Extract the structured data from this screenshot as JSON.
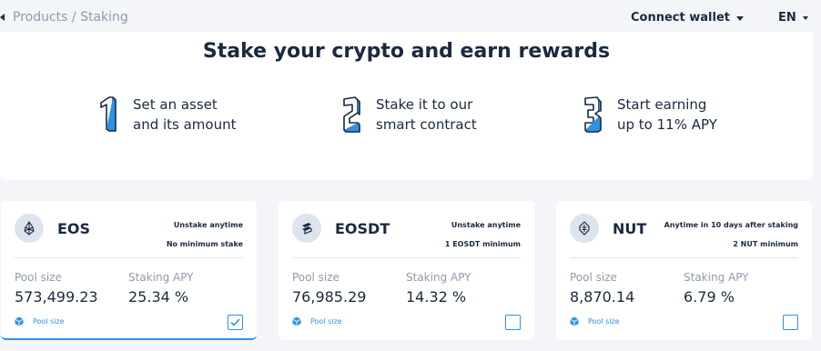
{
  "header": {
    "breadcrumb": "Products / Staking",
    "connect_wallet": "Connect wallet",
    "language": "EN"
  },
  "hero": {
    "title": "Stake your crypto and earn rewards",
    "steps": [
      {
        "line1": "Set an asset",
        "line2": "and its amount",
        "icon": "number-1-icon"
      },
      {
        "line1": "Stake it to our",
        "line2": "smart contract",
        "icon": "number-2-icon"
      },
      {
        "line1": "Start earning",
        "line2": "up to 11% APY",
        "icon": "number-3-icon"
      }
    ]
  },
  "colors": {
    "accent": "#2f91e8",
    "text": "#1b2940",
    "muted": "#8f9aad",
    "background": "#f3f5f9"
  },
  "pools": [
    {
      "name": "EOS",
      "icon": "eos-icon",
      "terms_line1": "Unstake anytime",
      "terms_line2": "No minimum stake",
      "pool_size_label": "Pool size",
      "pool_size": "573,499.23",
      "apy_label": "Staking APY",
      "apy": "25.34 %",
      "footer_link": "Pool size",
      "selected": true
    },
    {
      "name": "EOSDT",
      "icon": "eosdt-icon",
      "terms_line1": "Unstake anytime",
      "terms_line2": "1 EOSDT minimum",
      "pool_size_label": "Pool size",
      "pool_size": "76,985.29",
      "apy_label": "Staking APY",
      "apy": "14.32 %",
      "footer_link": "Pool size",
      "selected": false
    },
    {
      "name": "NUT",
      "icon": "nut-icon",
      "terms_line1": "Anytime in 10 days after staking",
      "terms_line2": "2 NUT minimum",
      "pool_size_label": "Pool size",
      "pool_size": "8,870.14",
      "apy_label": "Staking APY",
      "apy": "6.79 %",
      "footer_link": "Pool size",
      "selected": false
    }
  ]
}
